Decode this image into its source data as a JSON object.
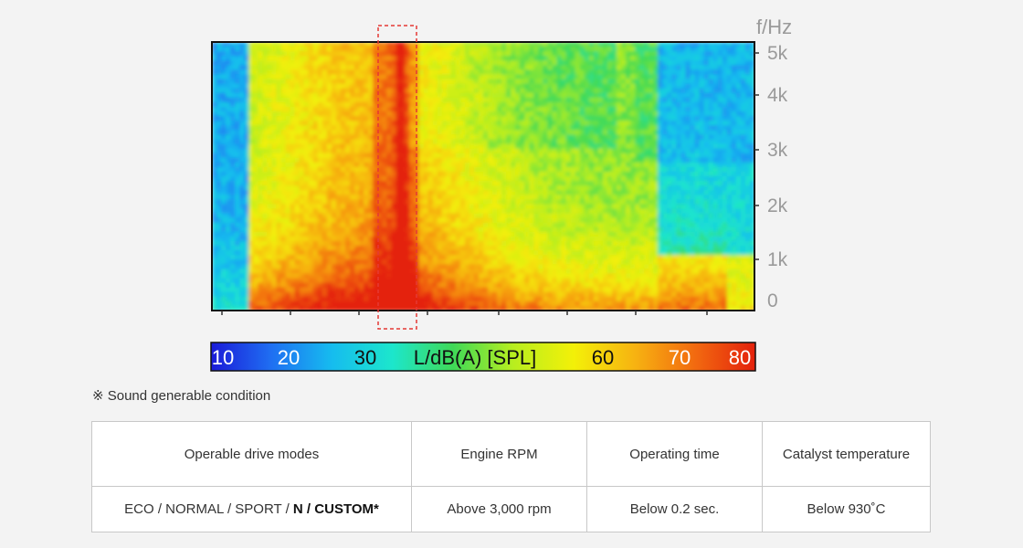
{
  "chart_data": {
    "type": "heatmap",
    "title": "",
    "ylabel": "f/Hz",
    "yticks": [
      "5k",
      "4k",
      "3k",
      "2k",
      "1k",
      "0"
    ],
    "xlabel": "",
    "colorbar": {
      "label": "L/dB(A) [SPL]",
      "ticks": [
        "10",
        "20",
        "30",
        "60",
        "70",
        "80"
      ],
      "range": [
        10,
        80
      ]
    },
    "highlight": "dashed red box marking a short full-band burst near 30% of the time axis",
    "x_tick_count": 8
  },
  "note": "※ Sound generable condition",
  "table": {
    "headers": [
      "Operable drive modes",
      "Engine RPM",
      "Operating time",
      "Catalyst temperature"
    ],
    "row": {
      "modes_plain": "ECO / NORMAL / SPORT / ",
      "modes_bold_1": "N",
      "modes_sep": " / ",
      "modes_bold_2": "CUSTOM*",
      "rpm": "Above 3,000 rpm",
      "time": "Below 0.2 sec.",
      "temp": "Below 930˚C"
    }
  },
  "colors": {
    "highlight_box": "#e53935",
    "colormap": [
      "#1b1bd8",
      "#1f6ff2",
      "#16bcef",
      "#1ce6cc",
      "#3fd957",
      "#b8ee1f",
      "#f3f008",
      "#f7b311",
      "#f26a10",
      "#e4210c"
    ]
  }
}
